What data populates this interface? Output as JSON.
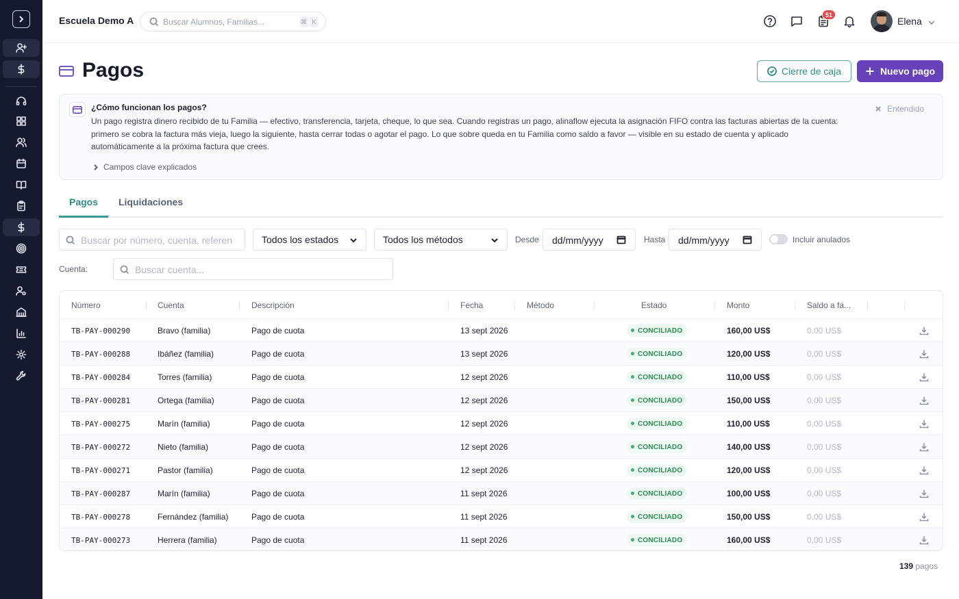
{
  "header": {
    "school_name": "Escuela Demo A",
    "search_placeholder": "Buscar Alumnos, Familias...",
    "shortcut_keys": [
      "⌘",
      "K"
    ],
    "notification_count": "51",
    "user_name": "Elena"
  },
  "page": {
    "title": "Pagos",
    "close_register_label": "Cierre de caja",
    "new_payment_label": "Nuevo pago"
  },
  "info": {
    "title": "¿Cómo funcionan los pagos?",
    "body": "Un pago registra dinero recibido de tu Familia — efectivo, transferencia, tarjeta, cheque, lo que sea. Cuando registras un pago, alinaflow ejecuta la asignación FIFO contra las facturas abiertas de la cuenta: primero se cobra la factura más vieja, luego la siguiente, hasta cerrar todas o agotar el pago. Lo que sobre queda en tu Familia como saldo a favor — visible en su estado de cuenta y aplicado automáticamente a la próxima factura que crees.",
    "more_label": "Campos clave explicados",
    "dismiss_label": "Entendido"
  },
  "tabs": [
    "Pagos",
    "Liquidaciones"
  ],
  "filters": {
    "search_placeholder": "Buscar por número, cuenta, referen",
    "status_value": "Todos los estados",
    "method_value": "Todos los métodos",
    "from_label": "Desde",
    "from_value": "dd/mm/yyyy",
    "to_label": "Hasta",
    "to_value": "dd/mm/yyyy",
    "include_voided_label": "Incluir anulados",
    "account_label": "Cuenta:",
    "account_placeholder": "Buscar cuenta..."
  },
  "table": {
    "columns": [
      "Número",
      "Cuenta",
      "Descripción",
      "Fecha",
      "Método",
      "Estado",
      "Monto",
      "Saldo a fa..."
    ],
    "rows": [
      {
        "number": "TB-PAY-000290",
        "account": "Bravo (familia)",
        "description": "Pago de cuota",
        "date": "13 sept 2026",
        "method": "",
        "status": "CONCILIADO",
        "amount": "160,00 US$",
        "balance": "0,00 US$"
      },
      {
        "number": "TB-PAY-000288",
        "account": "Ibáñez (familia)",
        "description": "Pago de cuota",
        "date": "13 sept 2026",
        "method": "",
        "status": "CONCILIADO",
        "amount": "120,00 US$",
        "balance": "0,00 US$"
      },
      {
        "number": "TB-PAY-000284",
        "account": "Torres (familia)",
        "description": "Pago de cuota",
        "date": "12 sept 2026",
        "method": "",
        "status": "CONCILIADO",
        "amount": "110,00 US$",
        "balance": "0,00 US$"
      },
      {
        "number": "TB-PAY-000281",
        "account": "Ortega (familia)",
        "description": "Pago de cuota",
        "date": "12 sept 2026",
        "method": "",
        "status": "CONCILIADO",
        "amount": "150,00 US$",
        "balance": "0,00 US$"
      },
      {
        "number": "TB-PAY-000275",
        "account": "Marín (familia)",
        "description": "Pago de cuota",
        "date": "12 sept 2026",
        "method": "",
        "status": "CONCILIADO",
        "amount": "110,00 US$",
        "balance": "0,00 US$"
      },
      {
        "number": "TB-PAY-000272",
        "account": "Nieto (familia)",
        "description": "Pago de cuota",
        "date": "12 sept 2026",
        "method": "",
        "status": "CONCILIADO",
        "amount": "140,00 US$",
        "balance": "0,00 US$"
      },
      {
        "number": "TB-PAY-000271",
        "account": "Pastor (familia)",
        "description": "Pago de cuota",
        "date": "12 sept 2026",
        "method": "",
        "status": "CONCILIADO",
        "amount": "120,00 US$",
        "balance": "0,00 US$"
      },
      {
        "number": "TB-PAY-000287",
        "account": "Marín (familia)",
        "description": "Pago de cuota",
        "date": "11 sept 2026",
        "method": "",
        "status": "CONCILIADO",
        "amount": "100,00 US$",
        "balance": "0,00 US$"
      },
      {
        "number": "TB-PAY-000278",
        "account": "Fernández (familia)",
        "description": "Pago de cuota",
        "date": "11 sept 2026",
        "method": "",
        "status": "CONCILIADO",
        "amount": "150,00 US$",
        "balance": "0,00 US$"
      },
      {
        "number": "TB-PAY-000273",
        "account": "Herrera (familia)",
        "description": "Pago de cuota",
        "date": "11 sept 2026",
        "method": "",
        "status": "CONCILIADO",
        "amount": "160,00 US$",
        "balance": "0,00 US$"
      }
    ]
  },
  "footer": {
    "count": "139",
    "count_label": "pagos"
  },
  "colors": {
    "sidebar_bg": "#151a2e",
    "primary": "#6741b9",
    "teal": "#2f8d84",
    "success": "#2c8a55"
  }
}
